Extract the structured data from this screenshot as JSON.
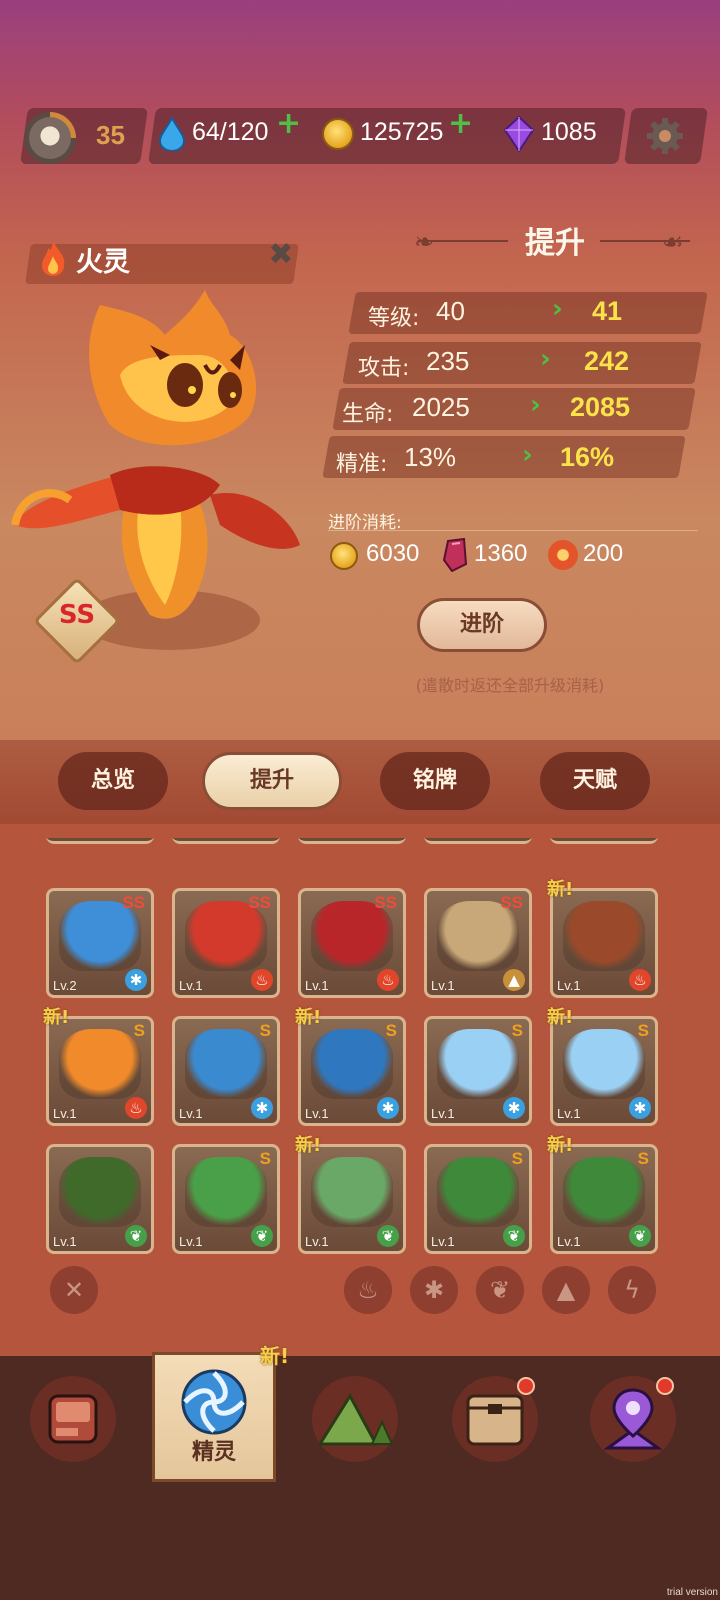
{
  "topbar": {
    "player_level": "35",
    "energy": "64/120",
    "coins": "125725",
    "gems": "1085",
    "plus": "+"
  },
  "spirit": {
    "name": "火灵",
    "rank": "SS"
  },
  "upgrade": {
    "title": "提升",
    "stats": [
      {
        "label": "等级:",
        "current": "40",
        "next": "41"
      },
      {
        "label": "攻击:",
        "current": "235",
        "next": "242"
      },
      {
        "label": "生命:",
        "current": "2025",
        "next": "2085"
      },
      {
        "label": "精准:",
        "current": "13%",
        "next": "16%"
      }
    ],
    "cost_label": "进阶消耗:",
    "costs": {
      "coins": "6030",
      "crystal": "1360",
      "orb": "200"
    },
    "advance_button": "进阶",
    "note": "(遣散时返还全部升级消耗)"
  },
  "tabs": [
    "总览",
    "提升",
    "铭牌",
    "天赋"
  ],
  "grid": {
    "new_label": "新!",
    "cards": [
      {
        "grade": "SS",
        "lv": "Lv.2",
        "elem": "ice",
        "new": false,
        "color": "#3e8fd8"
      },
      {
        "grade": "SS",
        "lv": "Lv.1",
        "elem": "fire",
        "new": false,
        "color": "#d33a2c"
      },
      {
        "grade": "SS",
        "lv": "Lv.1",
        "elem": "fire",
        "new": false,
        "color": "#b8262a"
      },
      {
        "grade": "SS",
        "lv": "Lv.1",
        "elem": "earth",
        "new": false,
        "color": "#c8a878"
      },
      {
        "grade": "",
        "lv": "Lv.1",
        "elem": "fire",
        "new": true,
        "color": "#9a4a2a"
      },
      {
        "grade": "S",
        "lv": "Lv.1",
        "elem": "fire",
        "new": true,
        "color": "#f08a2a"
      },
      {
        "grade": "S",
        "lv": "Lv.1",
        "elem": "ice",
        "new": false,
        "color": "#3a8ad0"
      },
      {
        "grade": "S",
        "lv": "Lv.1",
        "elem": "ice",
        "new": true,
        "color": "#2f78c0"
      },
      {
        "grade": "S",
        "lv": "Lv.1",
        "elem": "ice",
        "new": false,
        "color": "#9ad0f4"
      },
      {
        "grade": "S",
        "lv": "Lv.1",
        "elem": "ice",
        "new": true,
        "color": "#9ad0f4"
      },
      {
        "grade": "",
        "lv": "Lv.1",
        "elem": "leaf",
        "new": false,
        "color": "#3f6a2a"
      },
      {
        "grade": "S",
        "lv": "Lv.1",
        "elem": "leaf",
        "new": false,
        "color": "#4aa048"
      },
      {
        "grade": "",
        "lv": "Lv.1",
        "elem": "leaf",
        "new": true,
        "color": "#6aa868"
      },
      {
        "grade": "S",
        "lv": "Lv.1",
        "elem": "leaf",
        "new": false,
        "color": "#3e8a3a"
      },
      {
        "grade": "S",
        "lv": "Lv.1",
        "elem": "leaf",
        "new": true,
        "color": "#3e8a3a"
      }
    ]
  },
  "filters": [
    "clear-filter-icon",
    "fire-filter-icon",
    "ice-filter-icon",
    "leaf-filter-icon",
    "earth-filter-icon",
    "lightning-filter-icon"
  ],
  "nav": {
    "active_label": "精灵",
    "new_label": "新!"
  },
  "watermark": "trial version"
}
